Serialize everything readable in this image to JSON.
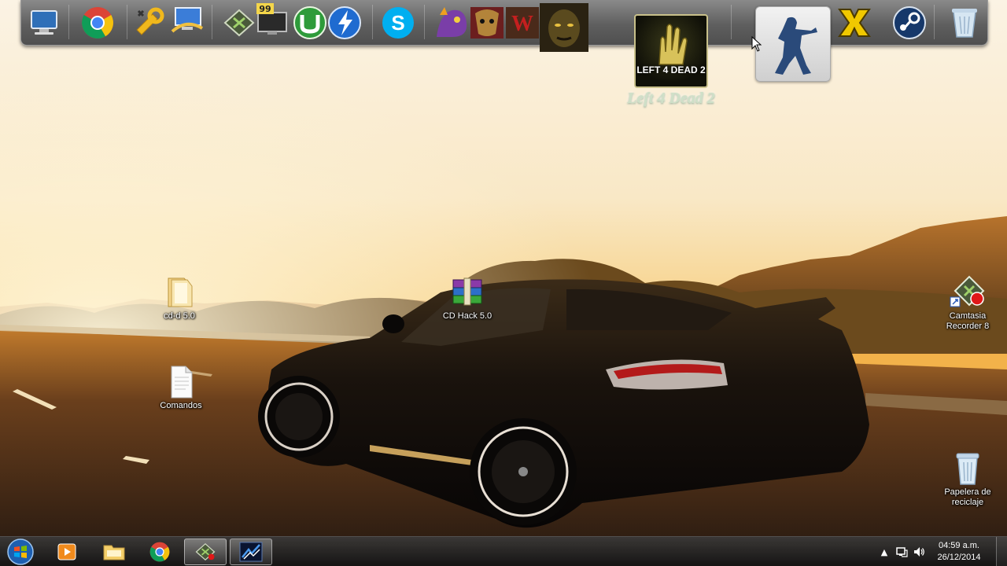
{
  "desktop": {
    "icons": [
      {
        "label": "cd-d 5.0",
        "type": "folder-icon"
      },
      {
        "label": "CD Hack 5.0",
        "type": "winrar-archive-icon"
      },
      {
        "label": "Comandos",
        "type": "text-document-icon"
      },
      {
        "label": "Camtasia Recorder 8",
        "type": "camtasia-recorder-icon"
      },
      {
        "label": "Papelera de reciclaje",
        "type": "recycle-bin-icon"
      }
    ]
  },
  "dock": {
    "items": [
      {
        "name": "computer-icon"
      },
      {
        "name": "chrome-icon"
      },
      {
        "name": "tools-icon"
      },
      {
        "name": "network-monitor-icon"
      },
      {
        "name": "camtasia-icon"
      },
      {
        "name": "monitor-icon",
        "badge": "99"
      },
      {
        "name": "utorrent-icon"
      },
      {
        "name": "daemon-tools-icon"
      },
      {
        "name": "skype-icon"
      },
      {
        "name": "game-spyro-icon"
      },
      {
        "name": "game-mask-icon"
      },
      {
        "name": "game-wolfenstein-icon"
      },
      {
        "name": "game-face-icon"
      },
      {
        "name": "left4dead2-icon"
      },
      {
        "name": "counter-strike-icon"
      },
      {
        "name": "xfire-icon"
      },
      {
        "name": "steam-icon"
      },
      {
        "name": "recycle-bin-icon"
      }
    ],
    "hover_label": "Left 4 Dead 2",
    "l4d_logo_text": "LEFT 4 DEAD 2"
  },
  "taskbar": {
    "pinned": [
      {
        "name": "media-player-icon"
      },
      {
        "name": "file-explorer-icon"
      },
      {
        "name": "chrome-icon"
      },
      {
        "name": "camtasia-icon"
      },
      {
        "name": "daemon-tools-icon"
      }
    ],
    "tray": {
      "time": "04:59 a.m.",
      "date": "26/12/2014",
      "show_hidden_glyph": "▲"
    }
  },
  "colors": {
    "sky_top": "#f8ead0",
    "sky_horizon": "#f6c26a",
    "road": "#3a2a1a",
    "car": "#141010",
    "dock_bg": "#6b6b6b",
    "taskbar_bg": "#262626"
  }
}
